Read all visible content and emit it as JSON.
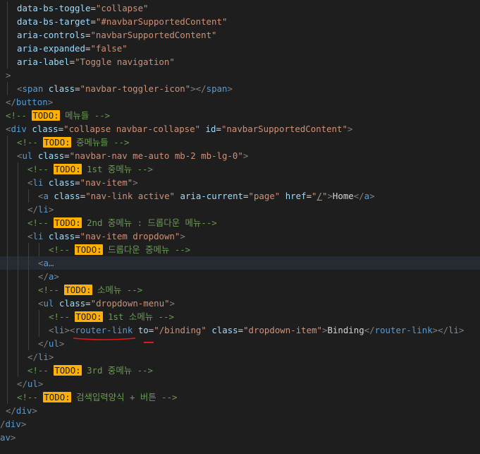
{
  "editor": {
    "lines": [
      {
        "indent": 24,
        "guides": [
          10
        ],
        "tokens": [
          {
            "c": "attr",
            "t": "data-bs-toggle"
          },
          {
            "c": "text",
            "t": "="
          },
          {
            "c": "str",
            "t": "\"collapse\""
          }
        ]
      },
      {
        "indent": 24,
        "guides": [
          10
        ],
        "tokens": [
          {
            "c": "attr",
            "t": "data-bs-target"
          },
          {
            "c": "text",
            "t": "="
          },
          {
            "c": "str",
            "t": "\"#navbarSupportedContent\""
          }
        ]
      },
      {
        "indent": 24,
        "guides": [
          10
        ],
        "tokens": [
          {
            "c": "attr",
            "t": "aria-controls"
          },
          {
            "c": "text",
            "t": "="
          },
          {
            "c": "str",
            "t": "\"navbarSupportedContent\""
          }
        ]
      },
      {
        "indent": 24,
        "guides": [
          10
        ],
        "tokens": [
          {
            "c": "attr",
            "t": "aria-expanded"
          },
          {
            "c": "text",
            "t": "="
          },
          {
            "c": "str",
            "t": "\"false\""
          }
        ]
      },
      {
        "indent": 24,
        "guides": [
          10
        ],
        "tokens": [
          {
            "c": "attr",
            "t": "aria-label"
          },
          {
            "c": "text",
            "t": "="
          },
          {
            "c": "str",
            "t": "\"Toggle navigation\""
          }
        ]
      },
      {
        "indent": 8,
        "guides": [],
        "tokens": [
          {
            "c": "gray",
            "t": ">"
          }
        ]
      },
      {
        "indent": 24,
        "guides": [
          10
        ],
        "tokens": [
          {
            "c": "gray",
            "t": "<"
          },
          {
            "c": "tag",
            "t": "span"
          },
          {
            "c": "text",
            "t": " "
          },
          {
            "c": "attr",
            "t": "class"
          },
          {
            "c": "text",
            "t": "="
          },
          {
            "c": "str",
            "t": "\"navbar-toggler-icon\""
          },
          {
            "c": "gray",
            "t": "></"
          },
          {
            "c": "tag",
            "t": "span"
          },
          {
            "c": "gray",
            "t": ">"
          }
        ]
      },
      {
        "indent": 8,
        "guides": [],
        "tokens": [
          {
            "c": "gray",
            "t": "</"
          },
          {
            "c": "tag",
            "t": "button"
          },
          {
            "c": "gray",
            "t": ">"
          }
        ]
      },
      {
        "indent": 8,
        "guides": [],
        "tokens": [
          {
            "c": "comment",
            "t": "<!-- "
          },
          {
            "c": "todo",
            "t": "TODO:"
          },
          {
            "c": "comment",
            "t": " 메뉴들 -->"
          }
        ]
      },
      {
        "indent": 8,
        "guides": [],
        "tokens": [
          {
            "c": "gray",
            "t": "<"
          },
          {
            "c": "tag",
            "t": "div"
          },
          {
            "c": "text",
            "t": " "
          },
          {
            "c": "attr",
            "t": "class"
          },
          {
            "c": "text",
            "t": "="
          },
          {
            "c": "str",
            "t": "\"collapse navbar-collapse\""
          },
          {
            "c": "text",
            "t": " "
          },
          {
            "c": "attr",
            "t": "id"
          },
          {
            "c": "text",
            "t": "="
          },
          {
            "c": "str",
            "t": "\"navbarSupportedContent\""
          },
          {
            "c": "gray",
            "t": ">"
          }
        ]
      },
      {
        "indent": 24,
        "guides": [
          10
        ],
        "tokens": [
          {
            "c": "comment",
            "t": "<!-- "
          },
          {
            "c": "todo",
            "t": "TODO:"
          },
          {
            "c": "comment",
            "t": " 중메뉴들 -->"
          }
        ]
      },
      {
        "indent": 24,
        "guides": [
          10
        ],
        "tokens": [
          {
            "c": "gray",
            "t": "<"
          },
          {
            "c": "tag",
            "t": "ul"
          },
          {
            "c": "text",
            "t": " "
          },
          {
            "c": "attr",
            "t": "class"
          },
          {
            "c": "text",
            "t": "="
          },
          {
            "c": "str",
            "t": "\"navbar-nav me-auto mb-2 mb-lg-0\""
          },
          {
            "c": "gray",
            "t": ">"
          }
        ]
      },
      {
        "indent": 39,
        "guides": [
          10,
          25
        ],
        "tokens": [
          {
            "c": "comment",
            "t": "<!-- "
          },
          {
            "c": "todo",
            "t": "TODO:"
          },
          {
            "c": "comment",
            "t": " 1st 중메뉴 -->"
          }
        ]
      },
      {
        "indent": 39,
        "guides": [
          10,
          25
        ],
        "tokens": [
          {
            "c": "gray",
            "t": "<"
          },
          {
            "c": "tag",
            "t": "li"
          },
          {
            "c": "text",
            "t": " "
          },
          {
            "c": "attr",
            "t": "class"
          },
          {
            "c": "text",
            "t": "="
          },
          {
            "c": "str",
            "t": "\"nav-item\""
          },
          {
            "c": "gray",
            "t": ">"
          }
        ]
      },
      {
        "indent": 54,
        "guides": [
          10,
          25,
          40
        ],
        "tokens": [
          {
            "c": "gray",
            "t": "<"
          },
          {
            "c": "tag",
            "t": "a"
          },
          {
            "c": "text",
            "t": " "
          },
          {
            "c": "attr",
            "t": "class"
          },
          {
            "c": "text",
            "t": "="
          },
          {
            "c": "str",
            "t": "\"nav-link active\""
          },
          {
            "c": "text",
            "t": " "
          },
          {
            "c": "attr",
            "t": "aria-current"
          },
          {
            "c": "text",
            "t": "="
          },
          {
            "c": "str",
            "t": "\"page\""
          },
          {
            "c": "text",
            "t": " "
          },
          {
            "c": "attr",
            "t": "href"
          },
          {
            "c": "text",
            "t": "="
          },
          {
            "c": "str",
            "t": "\""
          },
          {
            "c": "str-u",
            "t": "/"
          },
          {
            "c": "str",
            "t": "\""
          },
          {
            "c": "gray",
            "t": ">"
          },
          {
            "c": "text",
            "t": "Home"
          },
          {
            "c": "gray",
            "t": "</"
          },
          {
            "c": "tag",
            "t": "a"
          },
          {
            "c": "gray",
            "t": ">"
          }
        ]
      },
      {
        "indent": 39,
        "guides": [
          10,
          25
        ],
        "tokens": [
          {
            "c": "gray",
            "t": "</"
          },
          {
            "c": "tag",
            "t": "li"
          },
          {
            "c": "gray",
            "t": ">"
          }
        ]
      },
      {
        "indent": 39,
        "guides": [
          10,
          25
        ],
        "tokens": [
          {
            "c": "comment",
            "t": "<!-- "
          },
          {
            "c": "todo",
            "t": "TODO:"
          },
          {
            "c": "comment",
            "t": " 2nd 중메뉴 : 드롭다운 메뉴-->"
          }
        ]
      },
      {
        "indent": 39,
        "guides": [
          10,
          25
        ],
        "tokens": [
          {
            "c": "gray",
            "t": "<"
          },
          {
            "c": "tag",
            "t": "li"
          },
          {
            "c": "text",
            "t": " "
          },
          {
            "c": "attr",
            "t": "class"
          },
          {
            "c": "text",
            "t": "="
          },
          {
            "c": "str",
            "t": "\"nav-item dropdown\""
          },
          {
            "c": "gray",
            "t": ">"
          }
        ]
      },
      {
        "indent": 69,
        "guides": [
          10,
          25,
          40,
          55
        ],
        "tokens": [
          {
            "c": "comment",
            "t": "<!-- "
          },
          {
            "c": "todo",
            "t": "TODO:"
          },
          {
            "c": "comment",
            "t": " 드롭다운 중메뉴 -->"
          }
        ]
      },
      {
        "indent": 54,
        "guides": [
          10,
          25,
          40
        ],
        "current": true,
        "tokens": [
          {
            "c": "gray",
            "t": "<"
          },
          {
            "c": "tag",
            "t": "a"
          },
          {
            "c": "gray",
            "t": "…"
          }
        ]
      },
      {
        "indent": 54,
        "guides": [
          10,
          25,
          40
        ],
        "tokens": [
          {
            "c": "gray",
            "t": "</"
          },
          {
            "c": "tag",
            "t": "a"
          },
          {
            "c": "gray",
            "t": ">"
          }
        ]
      },
      {
        "indent": 54,
        "guides": [
          10,
          25,
          40
        ],
        "tokens": [
          {
            "c": "comment",
            "t": "<!-- "
          },
          {
            "c": "todo",
            "t": "TODO:"
          },
          {
            "c": "comment",
            "t": " 소메뉴 -->"
          }
        ]
      },
      {
        "indent": 54,
        "guides": [
          10,
          25,
          40
        ],
        "tokens": [
          {
            "c": "gray",
            "t": "<"
          },
          {
            "c": "tag",
            "t": "ul"
          },
          {
            "c": "text",
            "t": " "
          },
          {
            "c": "attr",
            "t": "class"
          },
          {
            "c": "text",
            "t": "="
          },
          {
            "c": "str",
            "t": "\"dropdown-menu\""
          },
          {
            "c": "gray",
            "t": ">"
          }
        ]
      },
      {
        "indent": 69,
        "guides": [
          10,
          25,
          40,
          55
        ],
        "tokens": [
          {
            "c": "comment",
            "t": "<!-- "
          },
          {
            "c": "todo",
            "t": "TODO:"
          },
          {
            "c": "comment",
            "t": " 1st 소메뉴 -->"
          }
        ]
      },
      {
        "indent": 69,
        "guides": [
          10,
          25,
          40,
          55
        ],
        "tokens": [
          {
            "c": "gray",
            "t": "<"
          },
          {
            "c": "tag",
            "t": "li"
          },
          {
            "c": "gray",
            "t": "><"
          },
          {
            "c": "tag",
            "t": "router-link"
          },
          {
            "c": "text",
            "t": " "
          },
          {
            "c": "attr",
            "t": "to"
          },
          {
            "c": "text",
            "t": "="
          },
          {
            "c": "str",
            "t": "\"/binding\""
          },
          {
            "c": "text",
            "t": " "
          },
          {
            "c": "attr",
            "t": "class"
          },
          {
            "c": "text",
            "t": "="
          },
          {
            "c": "str",
            "t": "\"dropdown-item\""
          },
          {
            "c": "gray",
            "t": ">"
          },
          {
            "c": "text",
            "t": "Binding"
          },
          {
            "c": "gray",
            "t": "</"
          },
          {
            "c": "tag",
            "t": "router-link"
          },
          {
            "c": "gray",
            "t": "></"
          },
          {
            "c": "tag",
            "t": "li"
          },
          {
            "c": "gray",
            "t": ">"
          }
        ]
      },
      {
        "indent": 54,
        "guides": [
          10,
          25,
          40
        ],
        "tokens": [
          {
            "c": "gray",
            "t": "</"
          },
          {
            "c": "tag",
            "t": "ul"
          },
          {
            "c": "gray",
            "t": ">"
          }
        ]
      },
      {
        "indent": 39,
        "guides": [
          10,
          25
        ],
        "tokens": [
          {
            "c": "gray",
            "t": "</"
          },
          {
            "c": "tag",
            "t": "li"
          },
          {
            "c": "gray",
            "t": ">"
          }
        ]
      },
      {
        "indent": 39,
        "guides": [
          10,
          25
        ],
        "tokens": [
          {
            "c": "comment",
            "t": "<!-- "
          },
          {
            "c": "todo",
            "t": "TODO:"
          },
          {
            "c": "comment",
            "t": " 3rd 중메뉴 -->"
          }
        ]
      },
      {
        "indent": 24,
        "guides": [
          10
        ],
        "tokens": [
          {
            "c": "gray",
            "t": "</"
          },
          {
            "c": "tag",
            "t": "ul"
          },
          {
            "c": "gray",
            "t": ">"
          }
        ]
      },
      {
        "indent": 24,
        "guides": [
          10
        ],
        "tokens": [
          {
            "c": "comment",
            "t": "<!-- "
          },
          {
            "c": "todo",
            "t": "TODO:"
          },
          {
            "c": "comment",
            "t": " 검색입력양식 + 버튼 -->"
          }
        ]
      },
      {
        "indent": 8,
        "guides": [],
        "tokens": [
          {
            "c": "gray",
            "t": "</"
          },
          {
            "c": "tag",
            "t": "div"
          },
          {
            "c": "gray",
            "t": ">"
          }
        ]
      },
      {
        "indent": 0,
        "guides": [],
        "tokens": [
          {
            "c": "gray",
            "t": "/"
          },
          {
            "c": "tag",
            "t": "div"
          },
          {
            "c": "gray",
            "t": ">"
          }
        ]
      },
      {
        "indent": 0,
        "guides": [],
        "tokens": [
          {
            "c": "tag",
            "t": "av"
          },
          {
            "c": "gray",
            "t": ">"
          }
        ]
      }
    ],
    "annotation_color": "#e01a1a"
  }
}
